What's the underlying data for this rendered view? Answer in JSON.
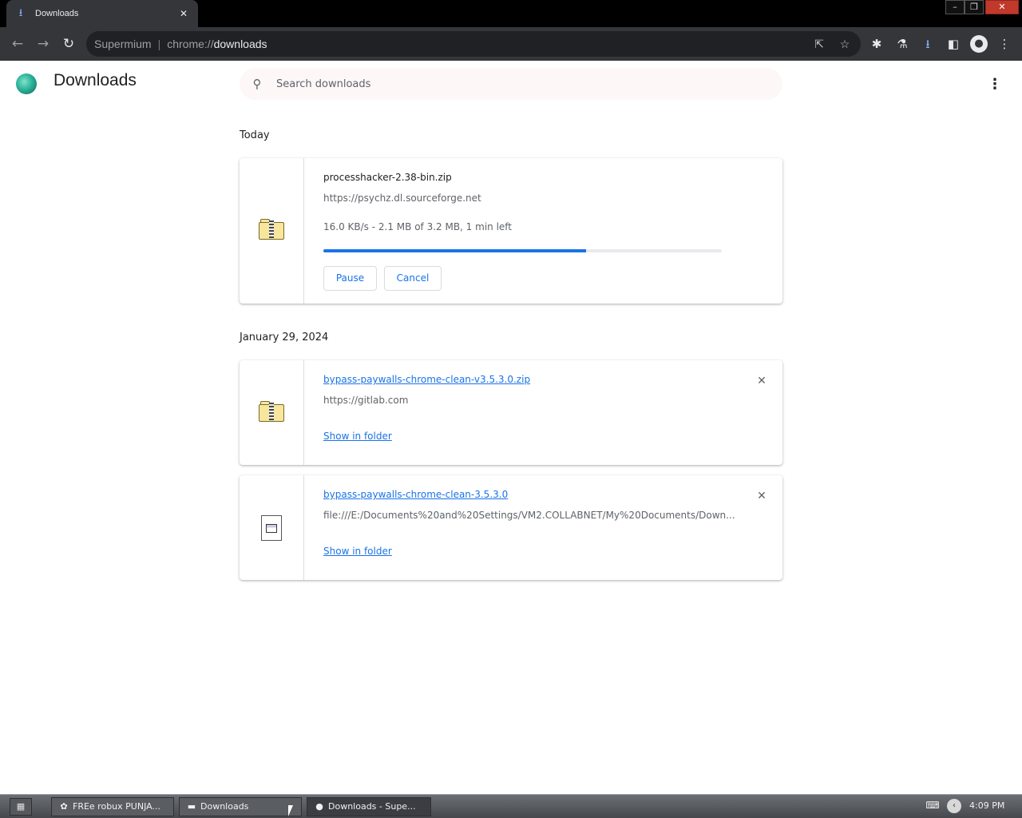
{
  "browser": {
    "tab_title": "Downloads",
    "tab_icon": "download-icon",
    "omnibox": {
      "host": "Supermium",
      "separator": "|",
      "scheme": "chrome://",
      "path": "downloads"
    },
    "accent_color": "#1a73e8"
  },
  "page": {
    "title": "Downloads",
    "search_placeholder": "Search downloads"
  },
  "groups": [
    {
      "date": "Today",
      "items": [
        {
          "file_name": "processhacker-2.38-bin.zip",
          "url": "https://psychz.dl.sourceforge.net",
          "status": "16.0 KB/s - 2.1 MB of 3.2 MB, 1 min left",
          "progress_fraction": 0.66,
          "pause_label": "Pause",
          "cancel_label": "Cancel",
          "icon": "zip-folder-icon"
        }
      ]
    },
    {
      "date": "January 29, 2024",
      "items": [
        {
          "file_name": "bypass-paywalls-chrome-clean-v3.5.3.0.zip",
          "url": "https://gitlab.com",
          "show_in_folder": "Show in folder",
          "icon": "zip-folder-icon"
        },
        {
          "file_name": "bypass-paywalls-chrome-clean-3.5.3.0",
          "url": "file:///E:/Documents%20and%20Settings/VM2.COLLABNET/My%20Documents/Down...",
          "show_in_folder": "Show in folder",
          "icon": "file-icon"
        }
      ]
    }
  ],
  "taskbar": {
    "tasks": [
      {
        "label": "FREe robux PUNJA...",
        "icon": "app-icon"
      },
      {
        "label": "Downloads",
        "icon": "folder-icon"
      },
      {
        "label": "Downloads - Supe...",
        "icon": "browser-icon"
      }
    ],
    "clock": "4:09 PM"
  }
}
